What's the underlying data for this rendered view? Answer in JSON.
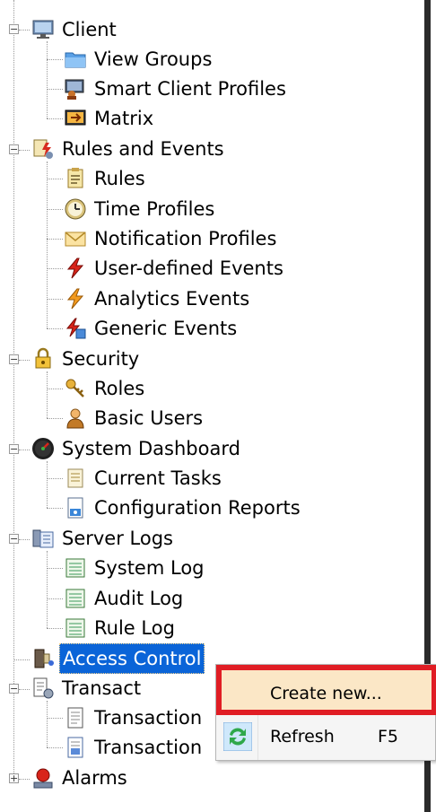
{
  "tree": {
    "groups": [
      {
        "label": "Client",
        "icon": "monitor-icon",
        "children": [
          {
            "label": "View Groups",
            "icon": "folder-icon"
          },
          {
            "label": "Smart Client Profiles",
            "icon": "client-profile-icon"
          },
          {
            "label": "Matrix",
            "icon": "matrix-icon"
          }
        ]
      },
      {
        "label": "Rules and Events",
        "icon": "rules-events-icon",
        "children": [
          {
            "label": "Rules",
            "icon": "rules-icon"
          },
          {
            "label": "Time Profiles",
            "icon": "clock-icon"
          },
          {
            "label": "Notification Profiles",
            "icon": "envelope-icon"
          },
          {
            "label": "User-defined Events",
            "icon": "lightning-red-icon"
          },
          {
            "label": "Analytics Events",
            "icon": "lightning-orange-icon"
          },
          {
            "label": "Generic Events",
            "icon": "generic-event-icon"
          }
        ]
      },
      {
        "label": "Security",
        "icon": "lock-icon",
        "children": [
          {
            "label": "Roles",
            "icon": "keys-icon"
          },
          {
            "label": "Basic Users",
            "icon": "user-icon"
          }
        ]
      },
      {
        "label": "System Dashboard",
        "icon": "gauge-icon",
        "children": [
          {
            "label": "Current Tasks",
            "icon": "task-list-icon"
          },
          {
            "label": "Configuration Reports",
            "icon": "report-icon"
          }
        ]
      },
      {
        "label": "Server Logs",
        "icon": "server-logs-icon",
        "children": [
          {
            "label": "System Log",
            "icon": "log-icon"
          },
          {
            "label": "Audit Log",
            "icon": "log-icon"
          },
          {
            "label": "Rule Log",
            "icon": "log-icon"
          }
        ]
      },
      {
        "label": "Access Control",
        "icon": "access-control-icon",
        "selected": true
      },
      {
        "label": "Transact",
        "icon": "transact-icon",
        "children": [
          {
            "label": "Transaction",
            "icon": "receipt-icon"
          },
          {
            "label": "Transaction",
            "icon": "transaction-def-icon"
          }
        ]
      },
      {
        "label": "Alarms",
        "icon": "alarm-icon"
      }
    ]
  },
  "context_menu": {
    "create_label": "Create new...",
    "refresh_label": "Refresh",
    "refresh_shortcut": "F5",
    "refresh_icon": "refresh-icon"
  },
  "colors": {
    "selection": "#0a64d8",
    "highlight_border": "#e01d24",
    "menu_hover": "#fbe7c6"
  }
}
